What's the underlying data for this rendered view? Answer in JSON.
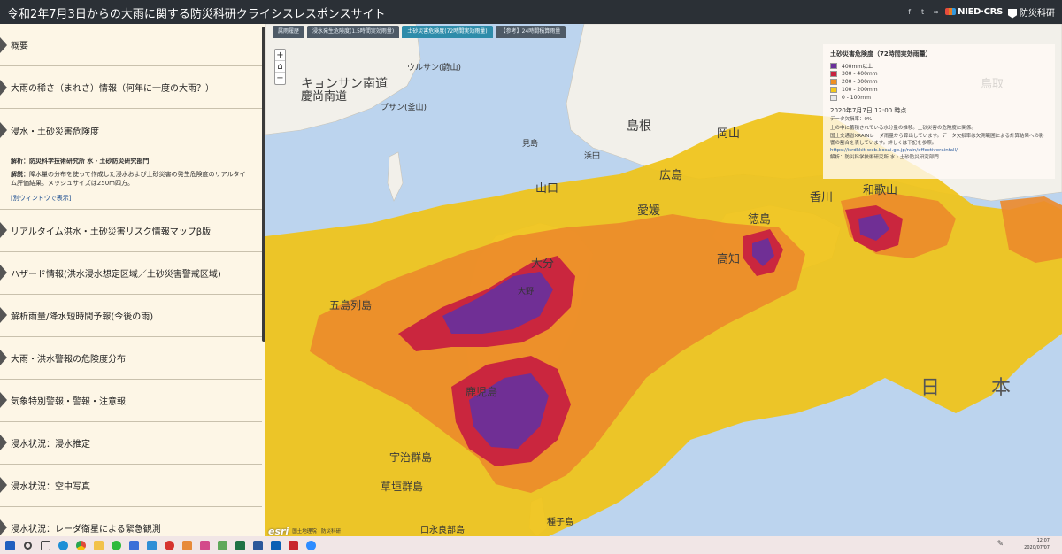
{
  "header": {
    "title": "令和2年7月3日からの大雨に関する防災科研クライシスレスポンスサイト",
    "social_icons": [
      "facebook-icon",
      "twitter-icon",
      "link-icon"
    ],
    "nied_logo": "NIED·CRS",
    "bosai_logo": "防災科研"
  },
  "sidebar": {
    "items": [
      {
        "label": "概要"
      },
      {
        "label": "大雨の稀さ（まれさ）情報（何年に一度の大雨？）"
      },
      {
        "label": "浸水・土砂災害危険度"
      },
      {
        "label": "リアルタイム洪水・土砂災害リスク情報マップβ版"
      },
      {
        "label": "ハザード情報(洪水浸水想定区域／土砂災害警戒区域)"
      },
      {
        "label": "解析雨量/降水短時間予報(今後の雨)"
      },
      {
        "label": "大雨・洪水警報の危険度分布"
      },
      {
        "label": "気象特別警報・警報・注意報"
      },
      {
        "label": "浸水状況：浸水推定"
      },
      {
        "label": "浸水状況：空中写真"
      },
      {
        "label": "浸水状況：レーダ衛星による緊急観測"
      }
    ],
    "detail": {
      "analysis": "解析：防災科学技術研究所 水・土砂防災研究部門",
      "explain_label": "解説：",
      "explain": "降水量の分布を使って作成した浸水および土砂災害の発生危険度のリアルタイム評価結果。メッシュサイズは250m四方。",
      "new_window": "[別ウィンドウで表示]"
    }
  },
  "map": {
    "tabs": [
      {
        "label": "属雨履歴"
      },
      {
        "label": "浸水発生危険度(1.5時間実効雨量)"
      },
      {
        "label": "土砂災害危険度(72時間実効雨量)",
        "active": true
      },
      {
        "label": "【参考】24時間積算雨量"
      }
    ],
    "zoom": {
      "in": "+",
      "home": "⌂",
      "out": "−"
    },
    "place_labels": [
      "ウルサン(蔚山)",
      "キョンサン南道",
      "慶尚南道",
      "プサン(釜山)",
      "鳥取",
      "島根",
      "岡山",
      "浜田",
      "山口",
      "見島",
      "広島",
      "香川",
      "徳島",
      "和歌山",
      "高知",
      "愛媛",
      "大分",
      "大野",
      "五島列島",
      "鹿児島",
      "宇治群島",
      "草垣群島",
      "口永良部島",
      "種子島",
      "日",
      "本"
    ],
    "legend": {
      "title": "土砂災害危険度（72時間実効雨量）",
      "rows": [
        {
          "label": "400mm以上",
          "color": "#6a2f9a"
        },
        {
          "label": "300 - 400mm",
          "color": "#c8213f"
        },
        {
          "label": "200 - 300mm",
          "color": "#ef8f21"
        },
        {
          "label": "100 - 200mm",
          "color": "#f3c81c"
        },
        {
          "label": "0 - 100mm",
          "color": "#e8e8e8"
        }
      ],
      "time": "2020年7月7日 12:00 時点",
      "missing": "データ欠損率：0%",
      "note1": "土の中に蓄積されている水分量の推移。土砂災害の危険度に関係。",
      "note2": "国土交通省XRAINレーダ雨量から算出しています。データ欠損率は欠測範囲による計算結果への影響の割合を表しています。詳しくは下記を参照。",
      "url": "https://isrdkkit-web.bosai.go.jp/rain/effectiverainfall/",
      "credit": "解析：防災科学技術研究所 水・土砂防災研究部門"
    },
    "attribution": {
      "esri": "esri",
      "text": "国土地理院 | 防災科研"
    }
  },
  "taskbar": {
    "clock_time": "12:07",
    "clock_date": "2020/07/07"
  }
}
